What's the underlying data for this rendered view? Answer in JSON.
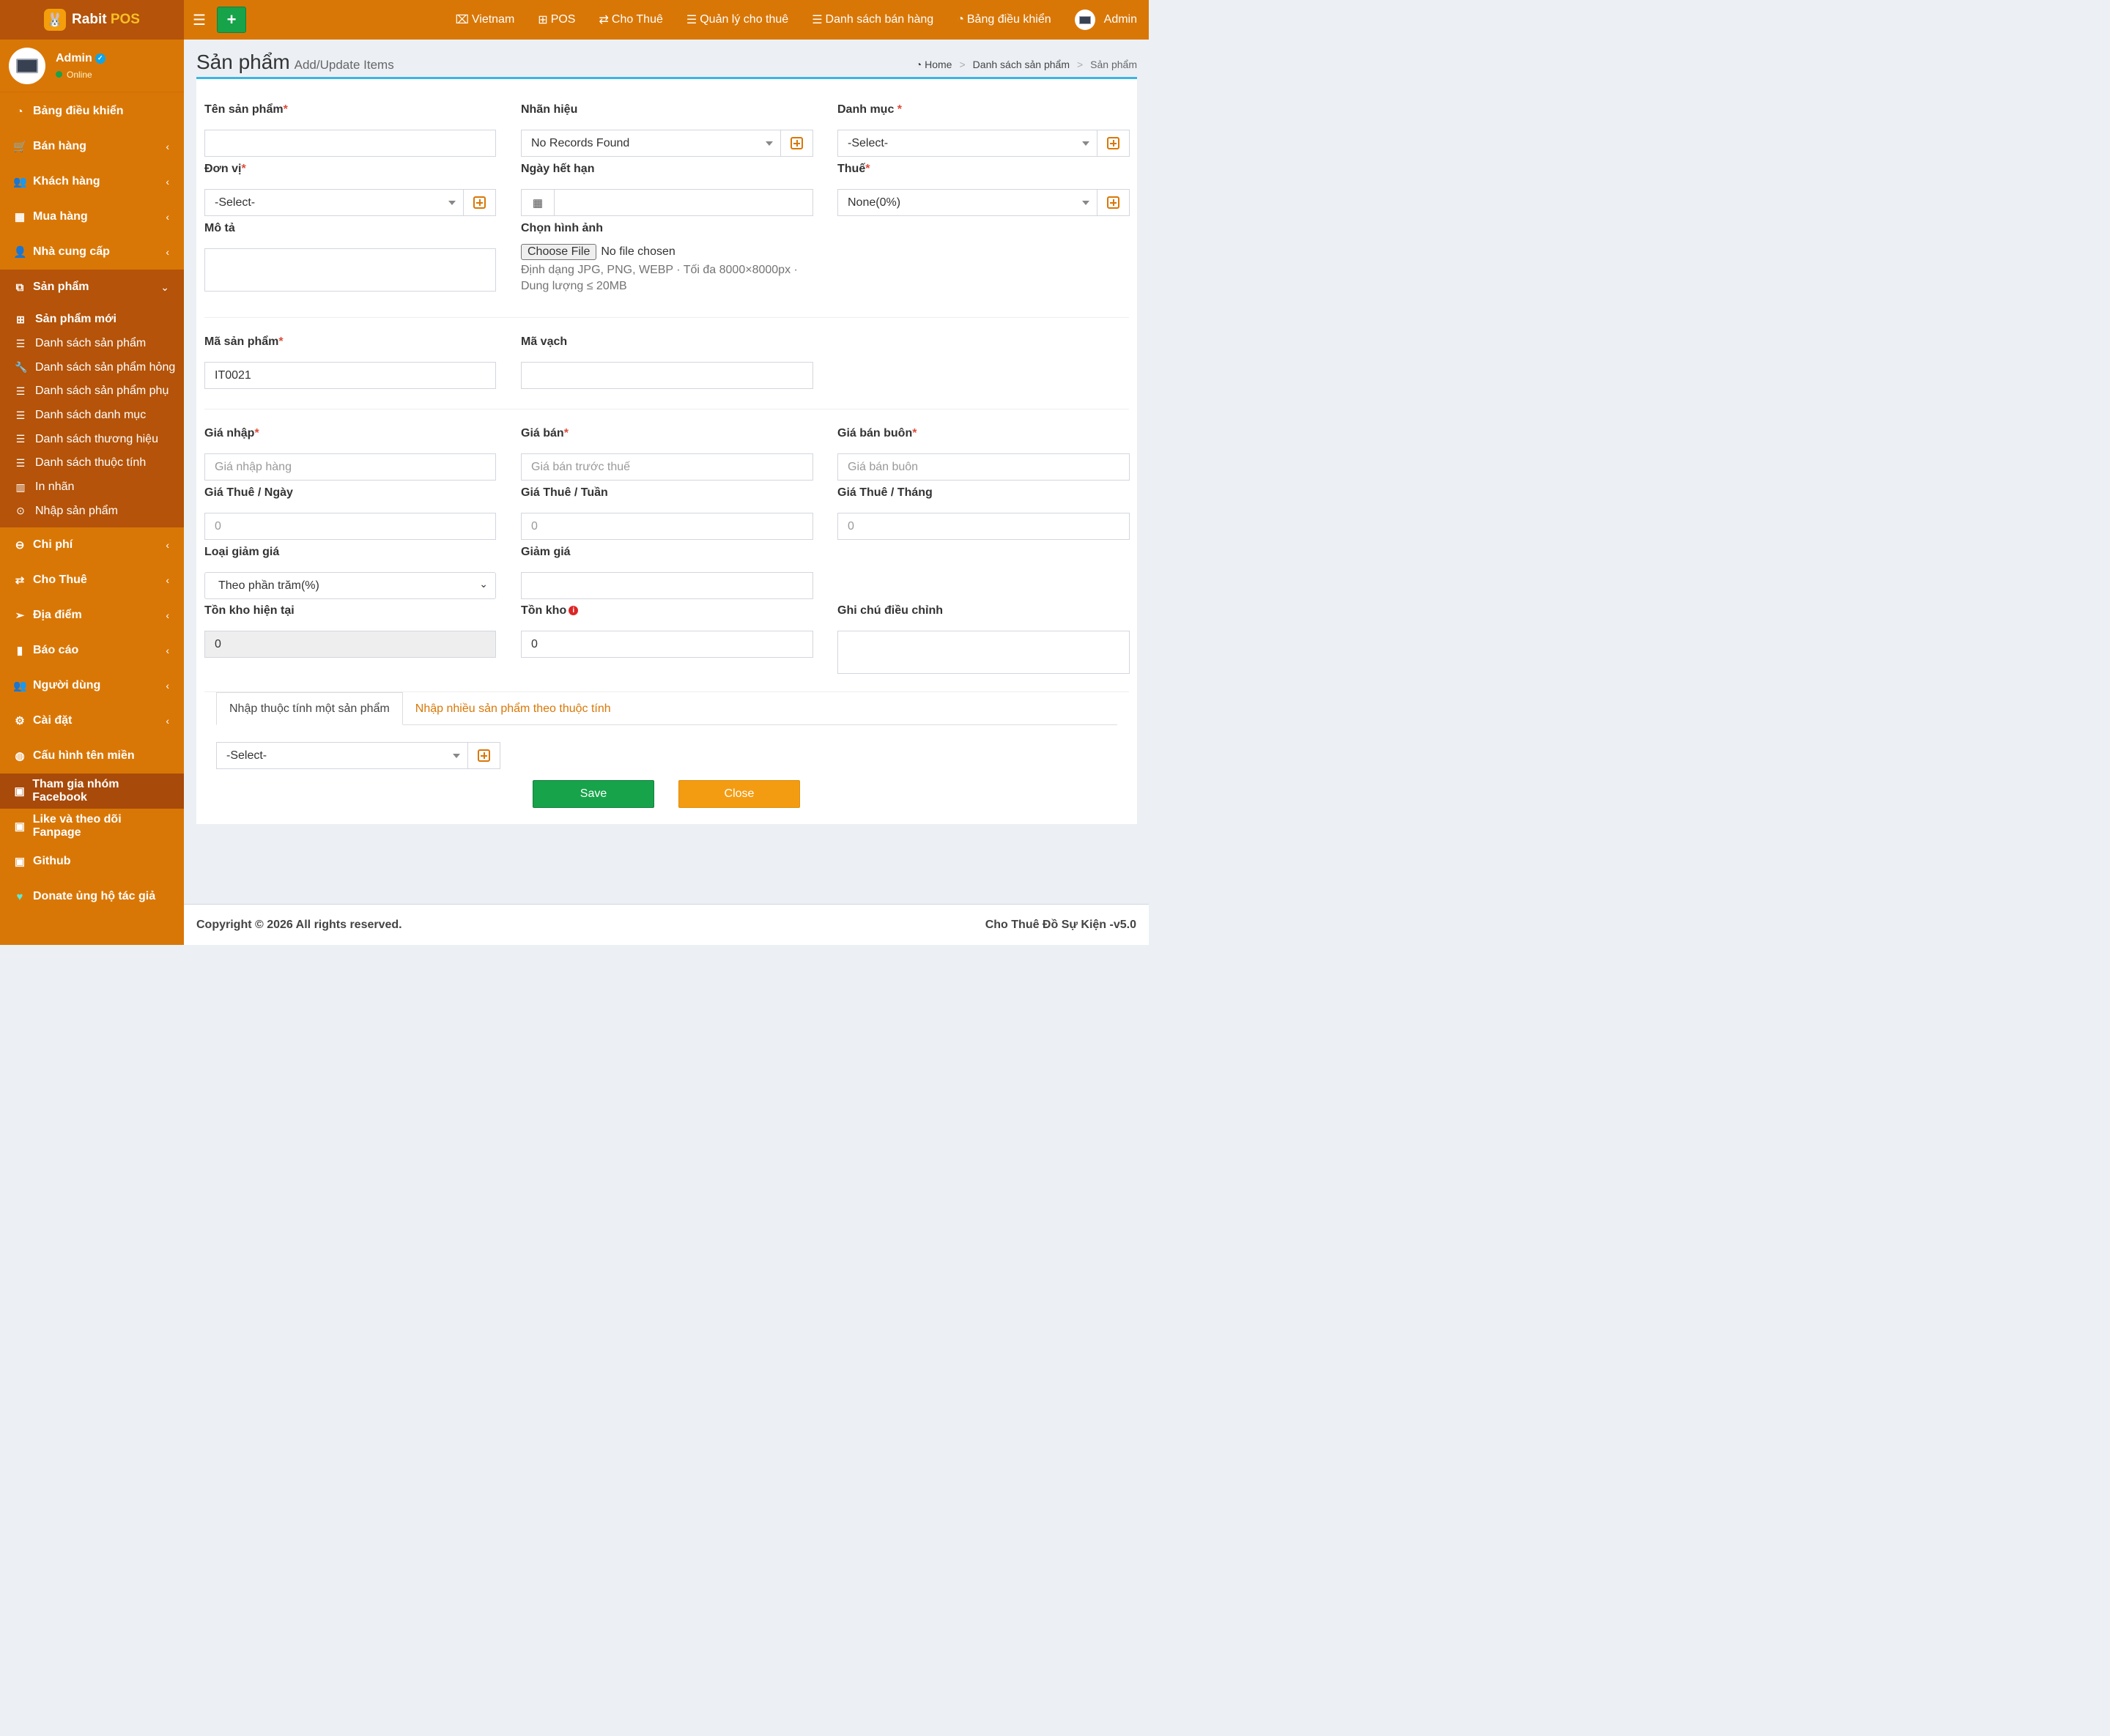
{
  "app": {
    "logo_text": "Rabit",
    "logo_accent": "POS",
    "brand_color": "#d97706",
    "accent_green": "#16a34a"
  },
  "user": {
    "name": "Admin",
    "status": "Online"
  },
  "sidebar": {
    "items": [
      {
        "label": "Bảng điều khiển",
        "icon": "dashboard-icon",
        "chevron": false
      },
      {
        "label": "Bán hàng",
        "icon": "cart-icon",
        "chevron": true
      },
      {
        "label": "Khách hàng",
        "icon": "users-icon",
        "chevron": true
      },
      {
        "label": "Mua hàng",
        "icon": "grid-icon",
        "chevron": true
      },
      {
        "label": "Nhà cung cấp",
        "icon": "user-plus-icon",
        "chevron": true
      },
      {
        "label": "Sản phẩm",
        "icon": "cubes-icon",
        "chevron": "down"
      }
    ],
    "sub_items": [
      {
        "label": "Sản phẩm mới",
        "icon": "plus-square-icon"
      },
      {
        "label": "Danh sách sản phẩm",
        "icon": "list-icon"
      },
      {
        "label": "Danh sách sản phẩm hỏng",
        "icon": "wrench-icon"
      },
      {
        "label": "Danh sách sản phẩm phụ",
        "icon": "list-icon"
      },
      {
        "label": "Danh sách danh mục",
        "icon": "list-icon"
      },
      {
        "label": "Danh sách thương hiệu",
        "icon": "list-icon"
      },
      {
        "label": "Danh sách thuộc tính",
        "icon": "list-icon"
      },
      {
        "label": "In nhãn",
        "icon": "barcode-icon"
      },
      {
        "label": "Nhập sản phẩm",
        "icon": "arrow-circle-icon"
      }
    ],
    "items_after": [
      {
        "label": "Chi phí",
        "icon": "minus-circle-icon",
        "chevron": true
      },
      {
        "label": "Cho Thuê",
        "icon": "exchange-icon",
        "chevron": true
      },
      {
        "label": "Địa điểm",
        "icon": "paper-plane-icon",
        "chevron": true
      },
      {
        "label": "Báo cáo",
        "icon": "bar-chart-icon",
        "chevron": true
      },
      {
        "label": "Người dùng",
        "icon": "users-icon",
        "chevron": true
      },
      {
        "label": "Cài đặt",
        "icon": "cogs-icon",
        "chevron": true
      },
      {
        "label": "Cấu hình tên miền",
        "icon": "globe-icon",
        "chevron": false
      },
      {
        "label": "Tham gia nhóm Facebook",
        "icon": "briefcase-icon",
        "chevron": false
      },
      {
        "label": "Like và theo dõi Fanpage",
        "icon": "briefcase-icon",
        "chevron": false
      },
      {
        "label": "Github",
        "icon": "briefcase-icon",
        "chevron": false
      },
      {
        "label": "Donate ủng hộ tác giả",
        "icon": "heart-icon",
        "chevron": false
      }
    ]
  },
  "topnav": {
    "links": [
      {
        "label": "Vietnam",
        "icon": "language-icon"
      },
      {
        "label": "POS",
        "icon": "plus-square-icon"
      },
      {
        "label": "Cho Thuê",
        "icon": "exchange-icon"
      },
      {
        "label": "Quản lý cho thuê",
        "icon": "list-icon"
      },
      {
        "label": "Danh sách bán hàng",
        "icon": "list-icon"
      },
      {
        "label": "Bảng điều khiển",
        "icon": "dashboard-icon"
      }
    ],
    "user": "Admin"
  },
  "page": {
    "title": "Sản phẩm",
    "subtitle": "Add/Update Items",
    "breadcrumb": [
      "Home",
      "Danh sách sản phẩm",
      "Sản phẩm"
    ]
  },
  "form": {
    "ten_san_pham": {
      "label": "Tên sản phẩm",
      "value": ""
    },
    "nhan_hieu": {
      "label": "Nhãn hiệu",
      "value": "No Records Found"
    },
    "danh_muc": {
      "label": "Danh mục ",
      "value": "-Select-"
    },
    "don_vi": {
      "label": "Đơn vị",
      "value": "-Select-"
    },
    "ngay_het_han": {
      "label": "Ngày hết hạn",
      "value": ""
    },
    "thue": {
      "label": "Thuế",
      "value": "None(0%)"
    },
    "mo_ta": {
      "label": "Mô tả",
      "value": ""
    },
    "chon_hinh_anh": {
      "label": "Chọn hình ảnh",
      "button": "Choose File",
      "status": "No file chosen",
      "help": "Định dạng JPG, PNG, WEBP · Tối đa 8000×8000px · Dung lượng ≤ 20MB"
    },
    "ma_san_pham": {
      "label": "Mã sản phẩm",
      "value": "IT0021"
    },
    "ma_vach": {
      "label": "Mã vạch",
      "value": ""
    },
    "gia_nhap": {
      "label": "Giá nhập",
      "placeholder": "Giá nhập hàng"
    },
    "gia_ban": {
      "label": "Giá bán",
      "placeholder": "Giá bán trước thuế"
    },
    "gia_ban_buon": {
      "label": "Giá bán buôn",
      "placeholder": "Giá bán buôn"
    },
    "gia_thue_ngay": {
      "label": "Giá Thuê / Ngày",
      "placeholder": "0"
    },
    "gia_thue_tuan": {
      "label": "Giá Thuê / Tuần",
      "placeholder": "0"
    },
    "gia_thue_thang": {
      "label": "Giá Thuê / Tháng",
      "placeholder": "0"
    },
    "loai_giam_gia": {
      "label": "Loại giảm giá",
      "value": "Theo phần trăm(%)"
    },
    "giam_gia": {
      "label": "Giảm giá",
      "value": ""
    },
    "ton_kho_hien_tai": {
      "label": "Tồn kho hiện tại",
      "value": "0"
    },
    "ton_kho": {
      "label": "Tồn kho",
      "value": "0"
    },
    "ghi_chu": {
      "label": "Ghi chú điều chỉnh",
      "value": ""
    },
    "required_mark": "*"
  },
  "tabs": [
    "Nhập thuộc tính một sản phẩm",
    "Nhập nhiều sản phẩm theo thuộc tính"
  ],
  "attribute_select": "-Select-",
  "buttons": {
    "save": "Save",
    "close": "Close"
  },
  "footer": {
    "copyright": "Copyright © 2026 All rights reserved.",
    "version": "Cho Thuê Đồ Sự Kiện -v5.0"
  }
}
